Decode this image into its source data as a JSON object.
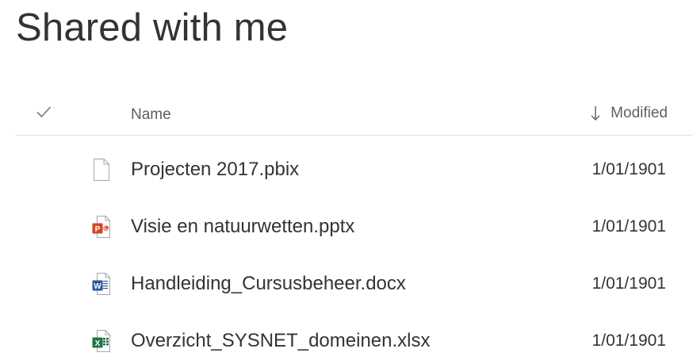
{
  "page": {
    "title": "Shared with me"
  },
  "columns": {
    "name": "Name",
    "modified": "Modified",
    "sort_direction": "descending",
    "sort_icon": "arrow-down-icon",
    "select_all_icon": "checkmark-icon"
  },
  "files": [
    {
      "name": "Projecten 2017.pbix",
      "modified": "1/01/1901",
      "icon": "generic-file-icon"
    },
    {
      "name": "Visie en natuurwetten.pptx",
      "modified": "1/01/1901",
      "icon": "powerpoint-file-icon"
    },
    {
      "name": "Handleiding_Cursusbeheer.docx",
      "modified": "1/01/1901",
      "icon": "word-file-icon"
    },
    {
      "name": "Overzicht_SYSNET_domeinen.xlsx",
      "modified": "1/01/1901",
      "icon": "excel-file-icon"
    }
  ],
  "colors": {
    "powerpoint": "#d24726",
    "word": "#2b579a",
    "excel": "#217346",
    "divider": "#e1e1e1"
  }
}
